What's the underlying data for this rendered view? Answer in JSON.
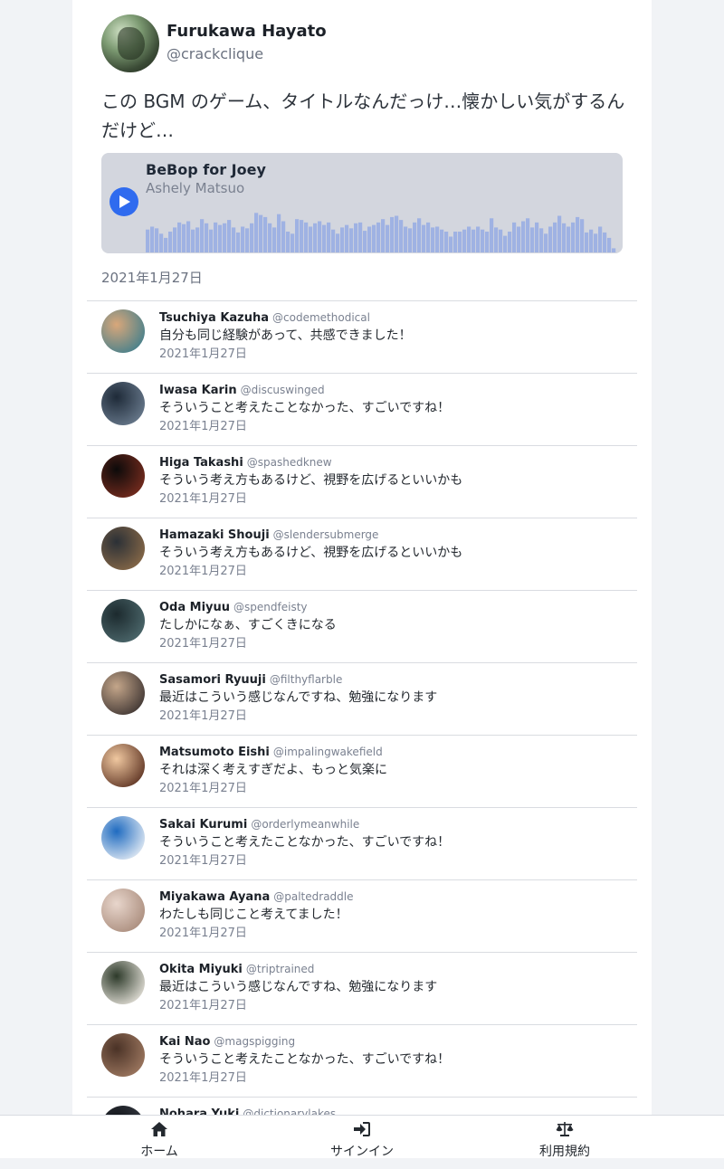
{
  "post": {
    "author_name": "Furukawa Hayato",
    "author_handle": "@crackclique",
    "text": "この BGM のゲーム、タイトルなんだっけ…懐かしい気がするんだけど…",
    "date": "2021年1月27日",
    "track": {
      "title": "BeBop for Joey",
      "artist": "Ashely Matsuo",
      "waveform_levels": [
        0.55,
        0.62,
        0.58,
        0.45,
        0.35,
        0.5,
        0.6,
        0.72,
        0.68,
        0.75,
        0.55,
        0.6,
        0.8,
        0.7,
        0.55,
        0.72,
        0.66,
        0.7,
        0.78,
        0.6,
        0.48,
        0.62,
        0.58,
        0.7,
        0.95,
        0.9,
        0.85,
        0.7,
        0.6,
        0.92,
        0.75,
        0.5,
        0.45,
        0.8,
        0.78,
        0.72,
        0.62,
        0.7,
        0.75,
        0.66,
        0.72,
        0.55,
        0.45,
        0.6,
        0.66,
        0.58,
        0.7,
        0.72,
        0.52,
        0.62,
        0.66,
        0.72,
        0.8,
        0.66,
        0.85,
        0.88,
        0.78,
        0.62,
        0.58,
        0.72,
        0.82,
        0.66,
        0.72,
        0.6,
        0.62,
        0.55,
        0.5,
        0.38,
        0.5,
        0.5,
        0.55,
        0.62,
        0.55,
        0.62,
        0.55,
        0.5,
        0.82,
        0.6,
        0.55,
        0.4,
        0.5,
        0.72,
        0.62,
        0.75,
        0.82,
        0.6,
        0.72,
        0.58,
        0.45,
        0.62,
        0.72,
        0.88,
        0.7,
        0.62,
        0.72,
        0.85,
        0.8,
        0.48,
        0.55,
        0.45,
        0.62,
        0.48,
        0.35,
        0.1
      ]
    }
  },
  "replies": [
    {
      "name": "Tsuchiya Kazuha",
      "handle": "@codemethodical",
      "text": "自分も同じ経験があって、共感できました！",
      "date": "2021年1月27日"
    },
    {
      "name": "Iwasa Karin",
      "handle": "@discuswinged",
      "text": "そういうこと考えたことなかった、すごいですね！",
      "date": "2021年1月27日"
    },
    {
      "name": "Higa Takashi",
      "handle": "@spashedknew",
      "text": "そういう考え方もあるけど、視野を広げるといいかも",
      "date": "2021年1月27日"
    },
    {
      "name": "Hamazaki Shouji",
      "handle": "@slendersubmerge",
      "text": "そういう考え方もあるけど、視野を広げるといいかも",
      "date": "2021年1月27日"
    },
    {
      "name": "Oda Miyuu",
      "handle": "@spendfeisty",
      "text": "たしかになぁ、すごくきになる",
      "date": "2021年1月27日"
    },
    {
      "name": "Sasamori Ryuuji",
      "handle": "@filthyflarble",
      "text": "最近はこういう感じなんですね、勉強になります",
      "date": "2021年1月27日"
    },
    {
      "name": "Matsumoto Eishi",
      "handle": "@impalingwakefield",
      "text": "それは深く考えすぎだよ、もっと気楽に",
      "date": "2021年1月27日"
    },
    {
      "name": "Sakai Kurumi",
      "handle": "@orderlymeanwhile",
      "text": "そういうこと考えたことなかった、すごいですね！",
      "date": "2021年1月27日"
    },
    {
      "name": "Miyakawa Ayana",
      "handle": "@paltedraddle",
      "text": "わたしも同じこと考えてました！",
      "date": "2021年1月27日"
    },
    {
      "name": "Okita Miyuki",
      "handle": "@triptrained",
      "text": "最近はこういう感じなんですね、勉強になります",
      "date": "2021年1月27日"
    },
    {
      "name": "Kai Nao",
      "handle": "@magspigging",
      "text": "そういうこと考えたことなかった、すごいですね！",
      "date": "2021年1月27日"
    },
    {
      "name": "Nohara Yuki",
      "handle": "@dictionarylakes",
      "text": "",
      "date": ""
    }
  ],
  "avatar_colors": [
    [
      "#d9a77a",
      "#3f7e8c"
    ],
    [
      "#1e2a38",
      "#6b7c8f"
    ],
    [
      "#0c0a0a",
      "#7a2d1f"
    ],
    [
      "#2b3036",
      "#8a6a48"
    ],
    [
      "#1c2a2e",
      "#4e6a6e"
    ],
    [
      "#c4a68a",
      "#3b3230"
    ],
    [
      "#f0c8a0",
      "#5a3020"
    ],
    [
      "#1f6bc0",
      "#e8eef5"
    ],
    [
      "#e8d6cc",
      "#a88a7a"
    ],
    [
      "#2d3a2a",
      "#e8e4dc"
    ],
    [
      "#4a3226",
      "#a07a62"
    ],
    [
      "#111318",
      "#3a3f48"
    ]
  ],
  "accent_color": "#2f6bef",
  "waveform_color": "#9fb2e3",
  "nav": {
    "home": "ホーム",
    "signin": "サインイン",
    "terms": "利用規約"
  }
}
